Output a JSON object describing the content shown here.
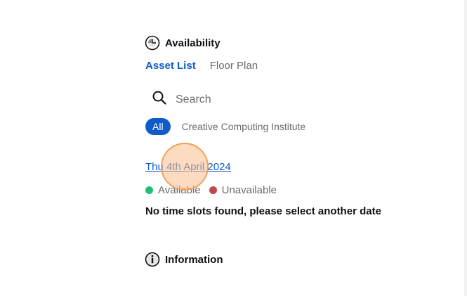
{
  "availability": {
    "title": "Availability",
    "icon": "clock-icon"
  },
  "tabs": [
    {
      "label": "Asset List",
      "active": true
    },
    {
      "label": "Floor Plan",
      "active": false
    }
  ],
  "search": {
    "placeholder": "Search",
    "value": "",
    "icon": "search-icon"
  },
  "filters": [
    {
      "label": "All",
      "active": true
    },
    {
      "label": "Creative Computing Institute",
      "active": false
    }
  ],
  "date": {
    "label": "Thu 4th April 2024"
  },
  "legend": [
    {
      "label": "Available",
      "color": "#1fbf73"
    },
    {
      "label": "Unavailable",
      "color": "#c0464a"
    }
  ],
  "message": "No time slots found, please select another date",
  "information": {
    "title": "Information",
    "icon": "info-icon"
  },
  "colors": {
    "accent": "#0f5bc9",
    "click_marker": "#f0a25a"
  }
}
